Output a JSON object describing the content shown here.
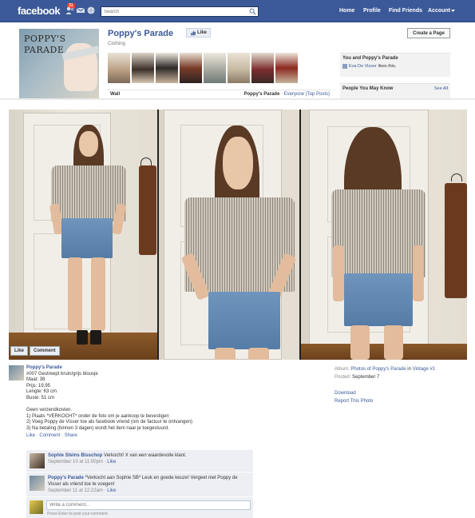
{
  "header": {
    "logo": "facebook",
    "notification_count": "31",
    "search_placeholder": "Search",
    "nav": [
      "Home",
      "Profile",
      "Find Friends",
      "Account"
    ]
  },
  "page": {
    "profile_text": "POPPY'S\nPARADE",
    "title": "Poppy's Parade",
    "category": "Clothing",
    "like_label": "Like",
    "create_page_label": "Create a Page",
    "wall_label": "Wall",
    "wall_filter_name": "Poppy's Parade",
    "wall_filter_sep": " · ",
    "wall_filter_option": "Everyone (Top Posts)"
  },
  "sidebar": {
    "you_and_title": "You and Poppy's Parade",
    "liker_name": "Eva De Visser",
    "liker_suffix": "likes this.",
    "people_title": "People You May Know",
    "see_all": "See All"
  },
  "photo": {
    "like_label": "Like",
    "comment_label": "Comment"
  },
  "post": {
    "author": "Poppy's Parade",
    "lines": [
      "#007 Gestreept bruin/grijs blousje",
      "Maat: 38",
      "Prijs: 19,95",
      "Lengte: 63 cm",
      "Buste: 51 cm",
      "",
      "Geen verzendkosten.",
      "1) Plaats *VERKOCHT* onder de foto om je aankoop te bevestigen",
      "2) Voeg Poppy de Visser toe als facebook vriend (om de factuur te ontvangen)",
      "3) Na betaling (binnen 3 dagen) wordt het item naar je toegestuurd."
    ],
    "actions": [
      "Like",
      "Comment",
      "Share"
    ],
    "action_sep": " · "
  },
  "meta": {
    "album_label": "Album:",
    "album_link": "Photos of Poppy's Parade",
    "album_in": " in ",
    "album_name": "Vintage #1",
    "posted_label": "Posted:",
    "posted_value": "September 7",
    "download": "Download",
    "report": "Report This Photo"
  },
  "comments": [
    {
      "name": "Sophie Steins Bisschop",
      "text": " Verkocht! X van een waardevolle klant.",
      "time": "September 10 at 11:00pm",
      "like": "Like"
    },
    {
      "name": "Poppy's Parade",
      "text": " *Verkocht aan Sophie SB* Leuk en goede keuze! Vergeet niet Poppy de Visser als vriend toe te voegen!",
      "time": "September 11 at 12:22am",
      "like": "Like"
    }
  ],
  "write_comment": {
    "placeholder": "Write a comment...",
    "hint": "Press Enter to post your comment."
  },
  "colors": {
    "brand": "#3b5998",
    "link": "#3b5998",
    "comment_bg": "#edeff4"
  }
}
